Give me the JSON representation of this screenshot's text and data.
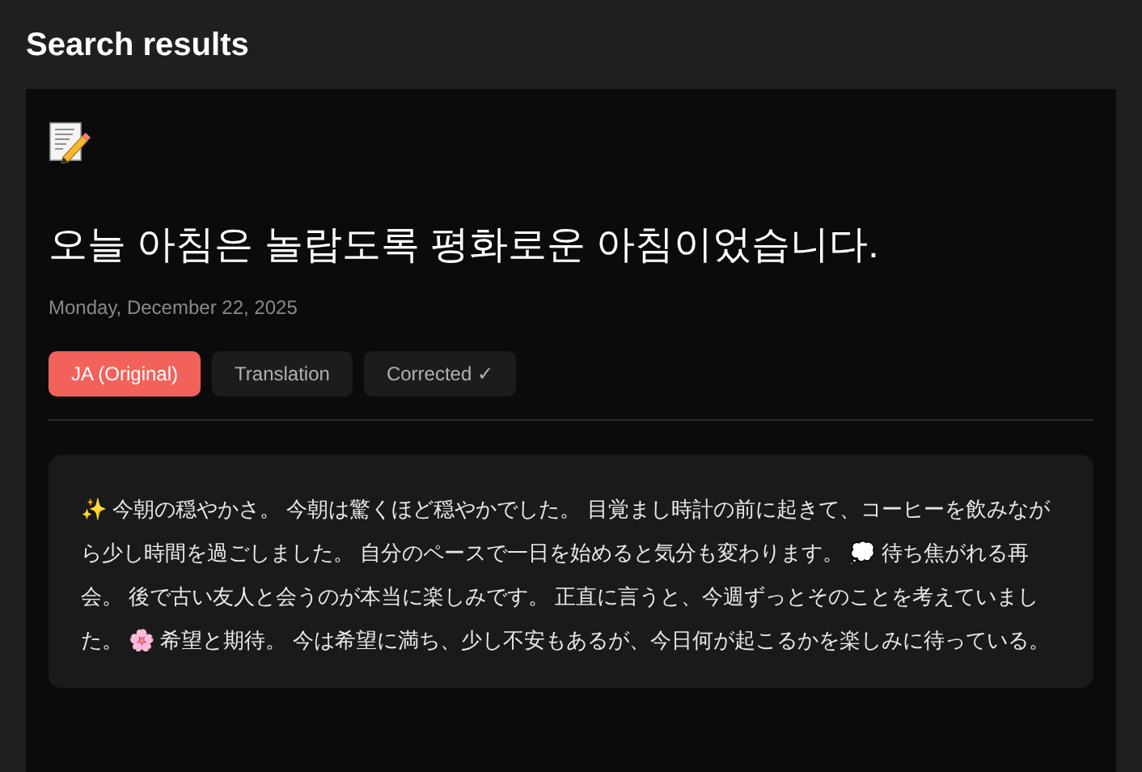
{
  "page": {
    "title": "Search results"
  },
  "entry": {
    "title": "오늘 아침은 놀랍도록 평화로운 아침이었습니다.",
    "date": "Monday, December 22, 2025",
    "tabs": [
      {
        "label": "JA (Original)",
        "selected": true
      },
      {
        "label": "Translation",
        "selected": false
      },
      {
        "label": "Corrected ✓",
        "selected": false
      }
    ],
    "body": "✨ 今朝の穏やかさ。 今朝は驚くほど穏やかでした。 目覚まし時計の前に起きて、コーヒーを飲みながら少し時間を過ごしました。 自分のペースで一日を始めると気分も変わります。 💭 待ち焦がれる再会。 後で古い友人と会うのが本当に楽しみです。 正直に言うと、今週ずっとそのことを考えていました。 🌸 希望と期待。 今は希望に満ち、少し不安もあるが、今日何が起こるかを楽しみに待っている。"
  }
}
